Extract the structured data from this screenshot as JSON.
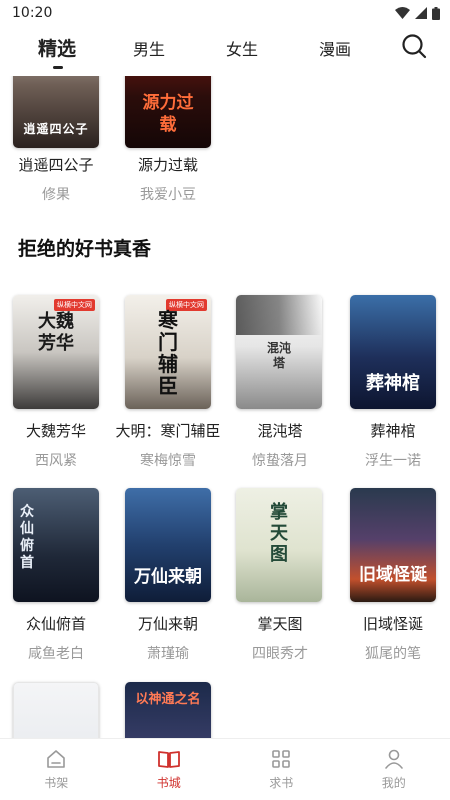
{
  "status_bar": {
    "time": "10:20"
  },
  "top_nav": {
    "tabs": [
      {
        "label": "精选",
        "active": true
      },
      {
        "label": "男生",
        "active": false
      },
      {
        "label": "女生",
        "active": false
      },
      {
        "label": "漫画",
        "active": false
      }
    ]
  },
  "previous_row": [
    {
      "title": "逍遥四公子",
      "author": "修果",
      "cover_text": "逍遥四公子"
    },
    {
      "title": "源力过载",
      "author": "我爱小豆",
      "cover_text": "源力过载"
    }
  ],
  "section": {
    "title": "拒绝的好书真香",
    "books": [
      {
        "title": "大魏芳华",
        "author": "西风紧",
        "cover_text": "大魏芳华",
        "badge": "纵横中文网"
      },
      {
        "title": "大明：寒门辅臣",
        "author": "寒梅惊雪",
        "cover_text": "寒门辅臣",
        "badge": "纵横中文网"
      },
      {
        "title": "混沌塔",
        "author": "惊蛰落月",
        "cover_text": "混沌塔"
      },
      {
        "title": "葬神棺",
        "author": "浮生一诺",
        "cover_text": "葬神棺"
      },
      {
        "title": "众仙俯首",
        "author": "咸鱼老白",
        "cover_text": "众仙俯首"
      },
      {
        "title": "万仙来朝",
        "author": "萧瑾瑜",
        "cover_text": "万仙来朝"
      },
      {
        "title": "掌天图",
        "author": "四眼秀才",
        "cover_text": "掌天图"
      },
      {
        "title": "旧域怪诞",
        "author": "狐尾的笔",
        "cover_text": "旧域怪诞"
      },
      {
        "title": "",
        "author": "",
        "cover_text": ""
      },
      {
        "title": "",
        "author": "",
        "cover_text": "以神通之名"
      }
    ]
  },
  "bottom_bar": {
    "items": [
      {
        "label": "书架",
        "active": false
      },
      {
        "label": "书城",
        "active": true
      },
      {
        "label": "求书",
        "active": false
      },
      {
        "label": "我的",
        "active": false
      }
    ]
  },
  "colors": {
    "accent": "#d0312d",
    "muted": "#999999"
  }
}
